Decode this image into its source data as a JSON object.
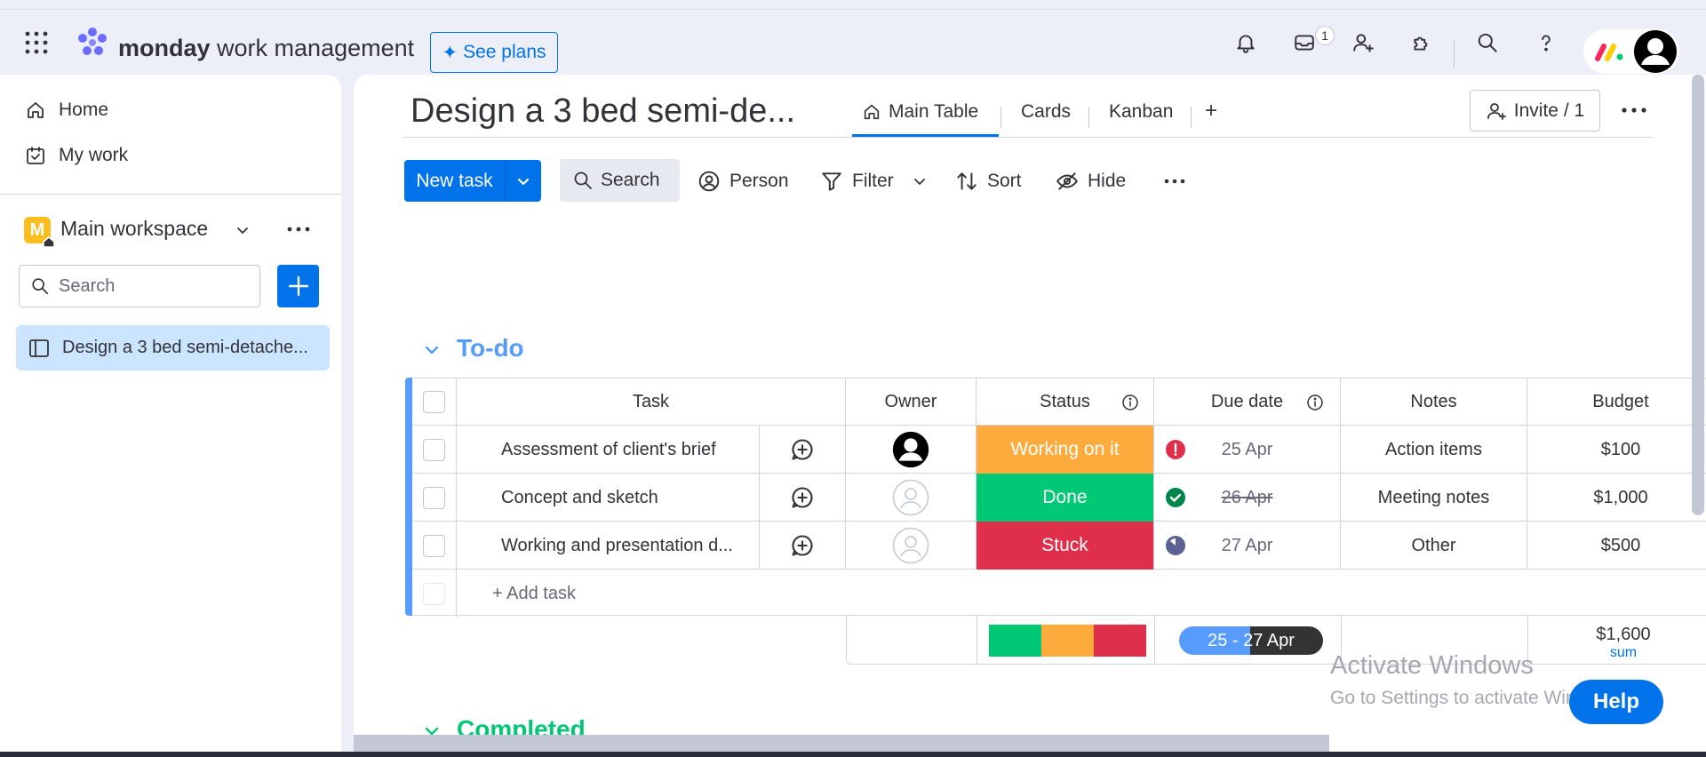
{
  "app": {
    "brand_bold": "monday",
    "brand_rest": " work management",
    "see_plans": "See plans",
    "inbox_count": "1"
  },
  "sidebar": {
    "home": "Home",
    "my_work": "My work",
    "workspace_initial": "M",
    "workspace_name": "Main workspace",
    "search_placeholder": "Search",
    "board_item": "Design a 3 bed semi-detache..."
  },
  "board": {
    "title": "Design a 3 bed semi-de...",
    "tabs": [
      "Main Table",
      "Cards",
      "Kanban"
    ],
    "add_view": "+",
    "invite": "Invite / 1"
  },
  "toolbar": {
    "new_task": "New task",
    "search": "Search",
    "person": "Person",
    "filter": "Filter",
    "sort": "Sort",
    "hide": "Hide"
  },
  "groups": [
    {
      "title": "To-do",
      "color": "#579bfc",
      "columns": [
        "Task",
        "Owner",
        "Status",
        "Due date",
        "Notes",
        "Budget"
      ],
      "rows": [
        {
          "task": "Assessment of client's brief",
          "owner": "filled",
          "status": "Working on it",
          "status_color": "#fdab3d",
          "due_icon": "alert",
          "due": "25 Apr",
          "notes": "Action items",
          "budget": "$100"
        },
        {
          "task": "Concept and sketch",
          "owner": "empty",
          "status": "Done",
          "status_color": "#00c875",
          "due_icon": "check",
          "due": "26 Apr",
          "notes": "Meeting notes",
          "budget": "$1,000"
        },
        {
          "task": "Working and presentation d...",
          "owner": "empty",
          "status": "Stuck",
          "status_color": "#df2f4a",
          "due_icon": "clock",
          "due": "27 Apr",
          "notes": "Other",
          "budget": "$500"
        }
      ],
      "add_task": "+ Add task",
      "summary": {
        "status_mix": [
          "#00c875",
          "#fdab3d",
          "#df2f4a"
        ],
        "date_range": "25 - 27 Apr",
        "budget_sum": "$1,600",
        "budget_sum_label": "sum"
      }
    },
    {
      "title": "Completed",
      "color": "#00c875"
    }
  ],
  "overlay": {
    "activate_title": "Activate Windows",
    "activate_sub": "Go to Settings to activate Windows.",
    "help": "Help"
  }
}
